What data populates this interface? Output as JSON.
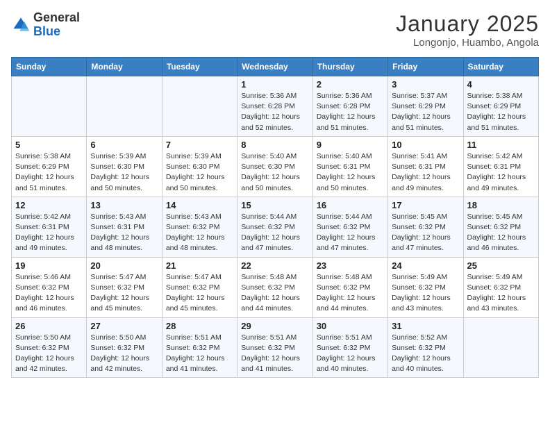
{
  "header": {
    "logo_general": "General",
    "logo_blue": "Blue",
    "month_year": "January 2025",
    "location": "Longonjo, Huambo, Angola"
  },
  "weekdays": [
    "Sunday",
    "Monday",
    "Tuesday",
    "Wednesday",
    "Thursday",
    "Friday",
    "Saturday"
  ],
  "weeks": [
    [
      {
        "day": "",
        "info": ""
      },
      {
        "day": "",
        "info": ""
      },
      {
        "day": "",
        "info": ""
      },
      {
        "day": "1",
        "info": "Sunrise: 5:36 AM\nSunset: 6:28 PM\nDaylight: 12 hours and 52 minutes."
      },
      {
        "day": "2",
        "info": "Sunrise: 5:36 AM\nSunset: 6:28 PM\nDaylight: 12 hours and 51 minutes."
      },
      {
        "day": "3",
        "info": "Sunrise: 5:37 AM\nSunset: 6:29 PM\nDaylight: 12 hours and 51 minutes."
      },
      {
        "day": "4",
        "info": "Sunrise: 5:38 AM\nSunset: 6:29 PM\nDaylight: 12 hours and 51 minutes."
      }
    ],
    [
      {
        "day": "5",
        "info": "Sunrise: 5:38 AM\nSunset: 6:29 PM\nDaylight: 12 hours and 51 minutes."
      },
      {
        "day": "6",
        "info": "Sunrise: 5:39 AM\nSunset: 6:30 PM\nDaylight: 12 hours and 50 minutes."
      },
      {
        "day": "7",
        "info": "Sunrise: 5:39 AM\nSunset: 6:30 PM\nDaylight: 12 hours and 50 minutes."
      },
      {
        "day": "8",
        "info": "Sunrise: 5:40 AM\nSunset: 6:30 PM\nDaylight: 12 hours and 50 minutes."
      },
      {
        "day": "9",
        "info": "Sunrise: 5:40 AM\nSunset: 6:31 PM\nDaylight: 12 hours and 50 minutes."
      },
      {
        "day": "10",
        "info": "Sunrise: 5:41 AM\nSunset: 6:31 PM\nDaylight: 12 hours and 49 minutes."
      },
      {
        "day": "11",
        "info": "Sunrise: 5:42 AM\nSunset: 6:31 PM\nDaylight: 12 hours and 49 minutes."
      }
    ],
    [
      {
        "day": "12",
        "info": "Sunrise: 5:42 AM\nSunset: 6:31 PM\nDaylight: 12 hours and 49 minutes."
      },
      {
        "day": "13",
        "info": "Sunrise: 5:43 AM\nSunset: 6:31 PM\nDaylight: 12 hours and 48 minutes."
      },
      {
        "day": "14",
        "info": "Sunrise: 5:43 AM\nSunset: 6:32 PM\nDaylight: 12 hours and 48 minutes."
      },
      {
        "day": "15",
        "info": "Sunrise: 5:44 AM\nSunset: 6:32 PM\nDaylight: 12 hours and 47 minutes."
      },
      {
        "day": "16",
        "info": "Sunrise: 5:44 AM\nSunset: 6:32 PM\nDaylight: 12 hours and 47 minutes."
      },
      {
        "day": "17",
        "info": "Sunrise: 5:45 AM\nSunset: 6:32 PM\nDaylight: 12 hours and 47 minutes."
      },
      {
        "day": "18",
        "info": "Sunrise: 5:45 AM\nSunset: 6:32 PM\nDaylight: 12 hours and 46 minutes."
      }
    ],
    [
      {
        "day": "19",
        "info": "Sunrise: 5:46 AM\nSunset: 6:32 PM\nDaylight: 12 hours and 46 minutes."
      },
      {
        "day": "20",
        "info": "Sunrise: 5:47 AM\nSunset: 6:32 PM\nDaylight: 12 hours and 45 minutes."
      },
      {
        "day": "21",
        "info": "Sunrise: 5:47 AM\nSunset: 6:32 PM\nDaylight: 12 hours and 45 minutes."
      },
      {
        "day": "22",
        "info": "Sunrise: 5:48 AM\nSunset: 6:32 PM\nDaylight: 12 hours and 44 minutes."
      },
      {
        "day": "23",
        "info": "Sunrise: 5:48 AM\nSunset: 6:32 PM\nDaylight: 12 hours and 44 minutes."
      },
      {
        "day": "24",
        "info": "Sunrise: 5:49 AM\nSunset: 6:32 PM\nDaylight: 12 hours and 43 minutes."
      },
      {
        "day": "25",
        "info": "Sunrise: 5:49 AM\nSunset: 6:32 PM\nDaylight: 12 hours and 43 minutes."
      }
    ],
    [
      {
        "day": "26",
        "info": "Sunrise: 5:50 AM\nSunset: 6:32 PM\nDaylight: 12 hours and 42 minutes."
      },
      {
        "day": "27",
        "info": "Sunrise: 5:50 AM\nSunset: 6:32 PM\nDaylight: 12 hours and 42 minutes."
      },
      {
        "day": "28",
        "info": "Sunrise: 5:51 AM\nSunset: 6:32 PM\nDaylight: 12 hours and 41 minutes."
      },
      {
        "day": "29",
        "info": "Sunrise: 5:51 AM\nSunset: 6:32 PM\nDaylight: 12 hours and 41 minutes."
      },
      {
        "day": "30",
        "info": "Sunrise: 5:51 AM\nSunset: 6:32 PM\nDaylight: 12 hours and 40 minutes."
      },
      {
        "day": "31",
        "info": "Sunrise: 5:52 AM\nSunset: 6:32 PM\nDaylight: 12 hours and 40 minutes."
      },
      {
        "day": "",
        "info": ""
      }
    ]
  ]
}
